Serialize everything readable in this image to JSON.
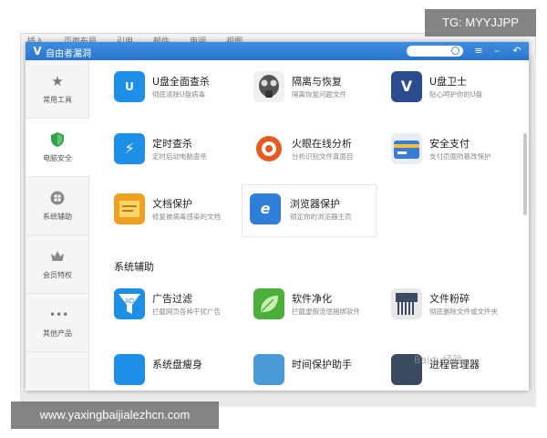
{
  "background_app": {
    "menu": [
      "插入",
      "页面布局",
      "引用",
      "邮件",
      "审阅",
      "视图"
    ]
  },
  "window": {
    "title": "自由者漏洞",
    "controls": {
      "menu": "≡",
      "minimize": "–",
      "back": "↶"
    }
  },
  "sidebar": {
    "items": [
      {
        "label": "常用工具",
        "icon": "star-icon"
      },
      {
        "label": "电脑安全",
        "icon": "shield-icon",
        "active": true
      },
      {
        "label": "系统辅助",
        "icon": "windows-icon"
      },
      {
        "label": "会员特权",
        "icon": "crown-icon"
      },
      {
        "label": "其他产品",
        "icon": "more-icon"
      }
    ]
  },
  "tools": [
    {
      "name": "U盘全面查杀",
      "desc": "彻底清除U盘病毒",
      "icon": "usb-scan-icon",
      "color": "#1e8fe6"
    },
    {
      "name": "隔离与恢复",
      "desc": "隔离恢复问题文件",
      "icon": "gas-mask-icon",
      "color": "#555555"
    },
    {
      "name": "U盘卫士",
      "desc": "贴心呵护你的U盘",
      "icon": "usb-guard-icon",
      "color": "#2a4b8d"
    },
    {
      "name": "定时查杀",
      "desc": "定时启动电脑查杀",
      "icon": "timer-scan-icon",
      "color": "#1e8fe6"
    },
    {
      "name": "火眼在线分析",
      "desc": "分析识别文件真面目",
      "icon": "fire-eye-icon",
      "color": "#e65a1e"
    },
    {
      "name": "安全支付",
      "desc": "支付页面防篡改保护",
      "icon": "secure-pay-icon",
      "color": "#3a7bd5"
    },
    {
      "name": "文档保护",
      "desc": "修复被病毒感染的文档",
      "icon": "document-protect-icon",
      "color": "#f0a020"
    },
    {
      "name": "浏览器保护",
      "desc": "锁定你的浏览器主页",
      "icon": "browser-protect-icon",
      "color": "#2f7fd8"
    }
  ],
  "section": {
    "title": "系统辅助"
  },
  "tools2": [
    {
      "name": "广告过滤",
      "desc": "拦截网页各种干扰广告",
      "icon": "ad-filter-icon",
      "color": "#1e8fe6"
    },
    {
      "name": "软件净化",
      "desc": "拦截虚假流氓捆绑软件",
      "icon": "leaf-icon",
      "color": "#4caf3c"
    },
    {
      "name": "文件粉碎",
      "desc": "彻底删除文件或文件夹",
      "icon": "shredder-icon",
      "color": "#3a4a60"
    },
    {
      "name": "系统盘瘦身",
      "desc": "",
      "icon": "disk-slim-icon",
      "color": "#1e8fe6"
    },
    {
      "name": "时间保护助手",
      "desc": "",
      "icon": "time-protect-icon",
      "color": "#4a9ad8"
    },
    {
      "name": "进程管理器",
      "desc": "",
      "icon": "process-manager-icon",
      "color": "#3a4a60"
    }
  ],
  "overlays": {
    "tg": "TG: MYYJJPP",
    "url": "www.yaxingbaijialezhcn.com",
    "watermark": "Baidu经验"
  }
}
